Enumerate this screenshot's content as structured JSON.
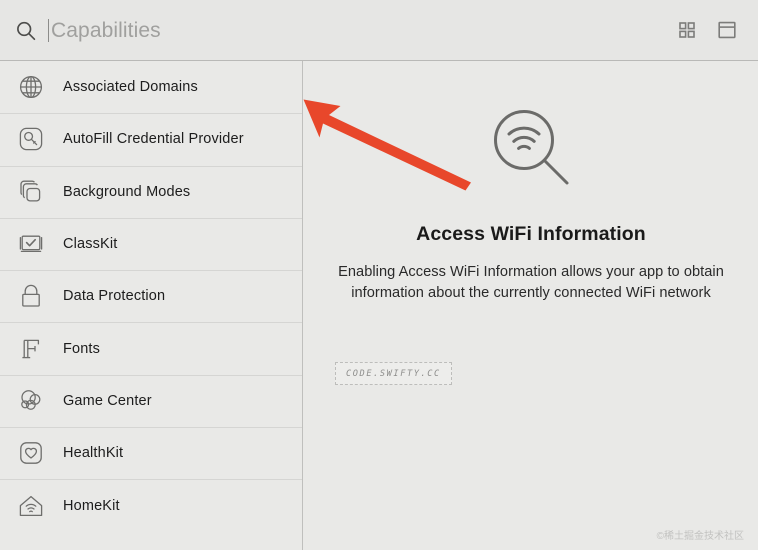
{
  "window": {
    "title": "Capabilities"
  },
  "header": {
    "search_icon": "search-icon",
    "search_value": "",
    "search_placeholder": "Capabilities",
    "buttons": [
      {
        "name": "grid-view-icon",
        "label": "Grid View"
      },
      {
        "name": "panel-toggle-icon",
        "label": "Toggle Inspector"
      }
    ]
  },
  "sidebar": {
    "items": [
      {
        "label": "Associated Domains",
        "icon": "globe-icon"
      },
      {
        "label": "AutoFill Credential Provider",
        "icon": "key-badge-icon"
      },
      {
        "label": "Background Modes",
        "icon": "stacked-squares-icon"
      },
      {
        "label": "ClassKit",
        "icon": "checkboard-icon"
      },
      {
        "label": "Data Protection",
        "icon": "lock-icon"
      },
      {
        "label": "Fonts",
        "icon": "serif-f-icon"
      },
      {
        "label": "Game Center",
        "icon": "game-balloons-icon"
      },
      {
        "label": "HealthKit",
        "icon": "heart-badge-icon"
      },
      {
        "label": "HomeKit",
        "icon": "house-wifi-icon"
      }
    ]
  },
  "detail": {
    "icon": "wifi-magnifier-icon",
    "title": "Access WiFi Information",
    "description": "Enabling Access WiFi Information allows your app to obtain information about the currently connected WiFi network"
  },
  "watermarks": {
    "stamp": "CODE.SWIFTY.CC",
    "corner": "©稀土掘金技术社区"
  },
  "annotation": {
    "arrow_color": "#E8472B",
    "arrow_name": "red-pointer-arrow"
  },
  "colors": {
    "window_bg": "#e9e9e7",
    "header_bg": "#e6e6e4",
    "divider": "#d5d5d3",
    "text_primary": "#1d1d1d",
    "text_placeholder": "#a0a09e",
    "icon_stroke": "#6e6e6c",
    "accent_red": "#E8472B"
  }
}
